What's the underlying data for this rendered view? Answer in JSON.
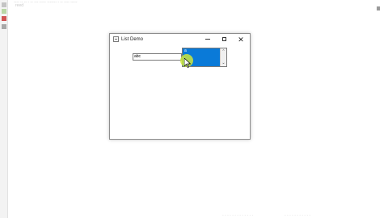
{
  "ide": {
    "top_text": "---- --  -- - -- ---  ----- ------- - -- ----  -----",
    "top_small": "reed",
    "bottom_text_1": "- - - - - - - - - - - - -",
    "bottom_text_2": "- - - - - - - - - - -"
  },
  "window": {
    "title": "List Demo",
    "minimize_label": "",
    "maximize_label": "",
    "close_label": "✕"
  },
  "form": {
    "text_field_value": "abc"
  },
  "list": {
    "selected_item": "a"
  },
  "colors": {
    "selection": "#0a7ad8",
    "cursor_highlight": "#cde63c"
  }
}
